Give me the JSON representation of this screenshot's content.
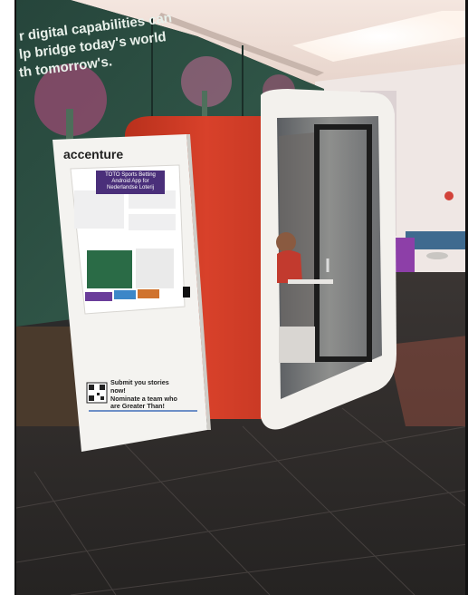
{
  "mural": {
    "line1": "r digital capabilities can",
    "line2": "lp bridge today's world",
    "line3": "th tomorrow's."
  },
  "standee": {
    "logo": "accenture",
    "poster_title": "TOTO Sports Betting Android App for Nederlandse Loterij",
    "cta": [
      "Submit you stories now!",
      "Nominate a team who",
      "are Greater Than!"
    ]
  },
  "colors": {
    "pod_red": "#d23b22",
    "pod_white": "#f3f1ed",
    "floor": "#2e2c2b",
    "accent_purple": "#6a3d9a"
  }
}
